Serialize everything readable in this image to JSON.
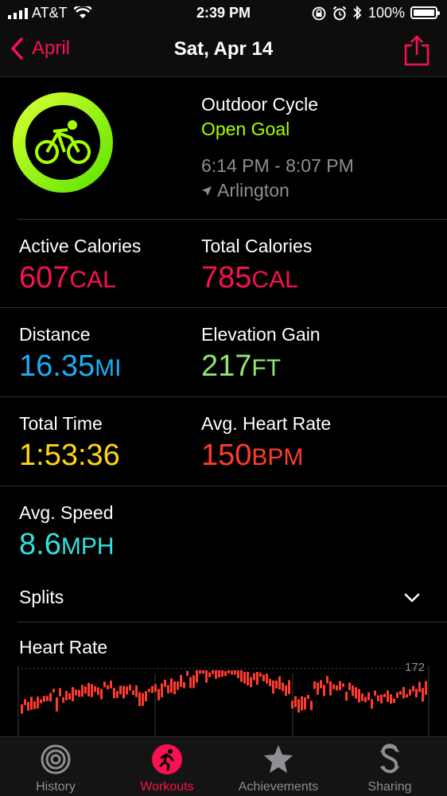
{
  "status": {
    "carrier": "AT&T",
    "time": "2:39 PM",
    "battery": "100%"
  },
  "nav": {
    "back_label": "April",
    "title": "Sat, Apr 14"
  },
  "workout": {
    "type": "Outdoor Cycle",
    "goal": "Open Goal",
    "time_range": "6:14 PM - 8:07 PM",
    "location": "Arlington"
  },
  "metrics": [
    {
      "label": "Active Calories",
      "value": "607",
      "unit": "CAL",
      "color": "#fa114f"
    },
    {
      "label": "Total Calories",
      "value": "785",
      "unit": "CAL",
      "color": "#fa114f"
    },
    {
      "label": "Distance",
      "value": "16.35",
      "unit": "MI",
      "color": "#1badf8"
    },
    {
      "label": "Elevation Gain",
      "value": "217",
      "unit": "FT",
      "color": "#8ee870"
    },
    {
      "label": "Total Time",
      "value": "1:53:36",
      "unit": "",
      "color": "#ffd60a"
    },
    {
      "label": "Avg. Heart Rate",
      "value": "150",
      "unit": "BPM",
      "color": "#ff3b30"
    },
    {
      "label": "Avg. Speed",
      "value": "8.6",
      "unit": "MPH",
      "color": "#32e0e0"
    }
  ],
  "splits_label": "Splits",
  "heart_rate": {
    "label": "Heart Rate",
    "max_label": "172"
  },
  "tabs": [
    {
      "label": "History",
      "icon": "history-rings-icon",
      "active": false
    },
    {
      "label": "Workouts",
      "icon": "running-figure-icon",
      "active": true
    },
    {
      "label": "Achievements",
      "icon": "star-award-icon",
      "active": false
    },
    {
      "label": "Sharing",
      "icon": "sharing-s-icon",
      "active": false
    }
  ],
  "colors": {
    "accent": "#fa114f",
    "goal": "#a6ff00",
    "heart": "#ff3b30"
  }
}
